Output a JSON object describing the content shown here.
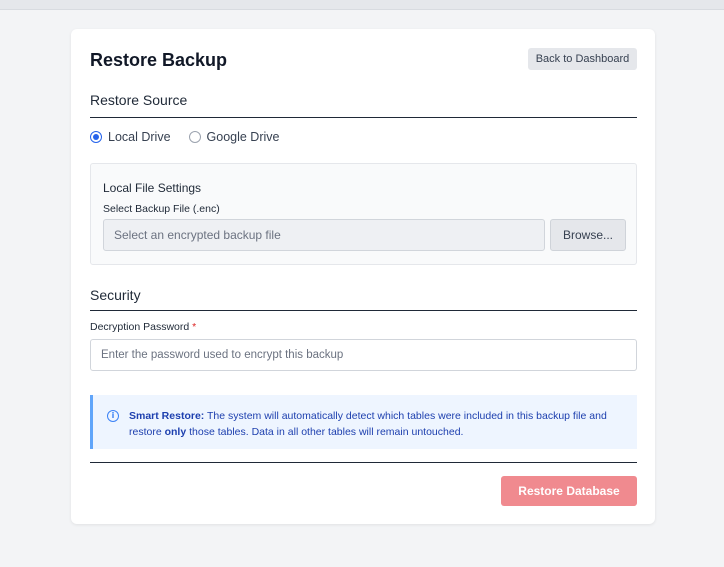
{
  "page": {
    "title": "Restore Backup",
    "back_button": "Back to Dashboard"
  },
  "restore_source": {
    "heading": "Restore Source",
    "options": [
      {
        "label": "Local Drive",
        "selected": true
      },
      {
        "label": "Google Drive",
        "selected": false
      }
    ]
  },
  "local_file_settings": {
    "heading": "Local File Settings",
    "file_label": "Select Backup File (.enc)",
    "file_placeholder": "Select an encrypted backup file",
    "browse_label": "Browse..."
  },
  "security": {
    "heading": "Security",
    "password_label": "Decryption Password",
    "required_marker": "*",
    "password_placeholder": "Enter the password used to encrypt this backup"
  },
  "notice": {
    "icon": "info-icon",
    "title": "Smart Restore:",
    "text_1": "The system will automatically detect which tables were included in this backup file and restore",
    "emphasis": "only",
    "text_2": "those tables. Data in all other tables will remain untouched."
  },
  "actions": {
    "restore_label": "Restore Database"
  },
  "colors": {
    "accent": "#2563eb",
    "restore_button": "#f08a8f",
    "notice_background": "#eef5ff",
    "notice_border": "#60a5fa",
    "required": "#dc2626"
  }
}
